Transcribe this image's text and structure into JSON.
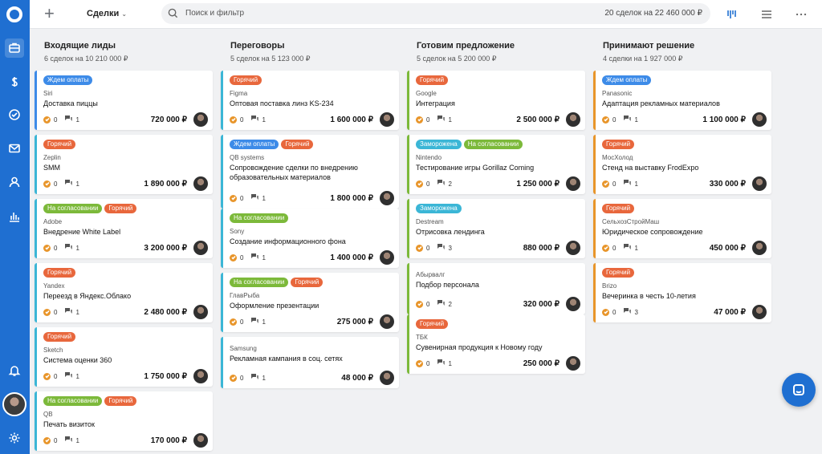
{
  "topbar": {
    "deals_label": "Сделки",
    "search_placeholder": "Поиск и фильтр",
    "deals_count": "20 сделок на 22 460 000 ₽"
  },
  "colors": {
    "ждем оплаты": "#3d8be8",
    "горячий": "#e8673c",
    "на согласовании": "#7cb93a",
    "заморожена": "#3bb6d6"
  },
  "columns": [
    {
      "title": "Входящие лиды",
      "subtitle": "6 сделок на 10 210 000 ₽",
      "cards": [
        {
          "tags": [
            "Ждем оплаты"
          ],
          "company": "Siri",
          "deal": "Доставка пиццы",
          "tasks": "0",
          "comments": "1",
          "amount": "720 000 ₽",
          "accent": "#3d8be8"
        },
        {
          "tags": [
            "Горячий"
          ],
          "company": "Zeplin",
          "deal": "SMM",
          "tasks": "0",
          "comments": "1",
          "amount": "1 890 000 ₽",
          "accent": "#3bb6d6"
        },
        {
          "tags": [
            "На согласовании",
            "Горячий"
          ],
          "company": "Adobe",
          "deal": "Внедрение White Label",
          "tasks": "0",
          "comments": "1",
          "amount": "3 200 000 ₽",
          "accent": "#3bb6d6"
        },
        {
          "tags": [
            "Горячий"
          ],
          "company": "Yandex",
          "deal": "Переезд в Яндекс.Облако",
          "tasks": "0",
          "comments": "1",
          "amount": "2 480 000 ₽",
          "accent": "#3bb6d6"
        },
        {
          "tags": [
            "Горячий"
          ],
          "company": "Sketch",
          "deal": "Система оценки 360",
          "tasks": "0",
          "comments": "1",
          "amount": "1 750 000 ₽",
          "accent": "#3bb6d6"
        },
        {
          "tags": [
            "На согласовании",
            "Горячий"
          ],
          "company": "QB",
          "deal": "Печать визиток",
          "tasks": "0",
          "comments": "1",
          "amount": "170 000 ₽",
          "accent": "#3bb6d6"
        }
      ]
    },
    {
      "title": "Переговоры",
      "subtitle": "5 сделок на 5 123 000 ₽",
      "cards": [
        {
          "tags": [
            "Горячий"
          ],
          "company": "Figma",
          "deal": "Оптовая поставка линз KS-234",
          "tasks": "0",
          "comments": "1",
          "amount": "1 600 000 ₽",
          "accent": "#3bb6d6"
        },
        {
          "tags": [
            "Ждем оплаты",
            "Горячий"
          ],
          "company": "QB systems",
          "deal": "Сопровождение сделки по внедрению образовательных материалов",
          "tasks": "0",
          "comments": "1",
          "amount": "1 800 000 ₽",
          "accent": "#3bb6d6"
        },
        {
          "tags": [
            "На согласовании"
          ],
          "company": "Sony",
          "deal": "Создание информационного фона",
          "tasks": "0",
          "comments": "1",
          "amount": "1 400 000 ₽",
          "accent": "#3bb6d6"
        },
        {
          "tags": [
            "На согласовании",
            "Горячий"
          ],
          "company": "ГлавРыба",
          "deal": "Оформление презентации",
          "tasks": "0",
          "comments": "1",
          "amount": "275 000 ₽",
          "accent": "#3bb6d6"
        },
        {
          "tags": [],
          "company": "Samsung",
          "deal": "Рекламная кампания в соц. сетях",
          "tasks": "0",
          "comments": "1",
          "amount": "48 000 ₽",
          "accent": "#3bb6d6"
        }
      ]
    },
    {
      "title": "Готовим предложение",
      "subtitle": "5 сделок на 5 200 000 ₽",
      "cards": [
        {
          "tags": [
            "Горячий"
          ],
          "company": "Google",
          "deal": "Интеграция",
          "tasks": "0",
          "comments": "1",
          "amount": "2 500 000 ₽",
          "accent": "#7cb93a"
        },
        {
          "tags": [
            "Заморожена",
            "На согласовании"
          ],
          "company": "Nintendo",
          "deal": "Тестирование игры Gorillaz Coming",
          "tasks": "0",
          "comments": "2",
          "amount": "1 250 000 ₽",
          "accent": "#7cb93a"
        },
        {
          "tags": [
            "Заморожена"
          ],
          "company": "Destream",
          "deal": "Отрисовка лендинга",
          "tasks": "0",
          "comments": "3",
          "amount": "880 000 ₽",
          "accent": "#7cb93a"
        },
        {
          "tags": [],
          "company": "Абырвалг",
          "deal": "Подбор персонала",
          "tasks": "0",
          "comments": "2",
          "amount": "320 000 ₽",
          "accent": "#7cb93a"
        },
        {
          "tags": [
            "Горячий"
          ],
          "company": "ТБК",
          "deal": "Сувенирная продукция к Новому году",
          "tasks": "0",
          "comments": "1",
          "amount": "250 000 ₽",
          "accent": "#7cb93a"
        }
      ]
    },
    {
      "title": "Принимают решение",
      "subtitle": "4 сделки на 1 927 000 ₽",
      "cards": [
        {
          "tags": [
            "Ждем оплаты"
          ],
          "company": "Panasonic",
          "deal": "Адаптация рекламных материалов",
          "tasks": "0",
          "comments": "1",
          "amount": "1 100 000 ₽",
          "accent": "#e8952a"
        },
        {
          "tags": [
            "Горячий"
          ],
          "company": "МосХолод",
          "deal": "Стенд на выставку FrodExpo",
          "tasks": "0",
          "comments": "1",
          "amount": "330 000 ₽",
          "accent": "#e8952a"
        },
        {
          "tags": [
            "Горячий"
          ],
          "company": "СельхозСтройМаш",
          "deal": "Юридическое сопровождение",
          "tasks": "0",
          "comments": "1",
          "amount": "450 000 ₽",
          "accent": "#e8952a"
        },
        {
          "tags": [
            "Горячий"
          ],
          "company": "Brizo",
          "deal": "Вечеринка в честь 10-летия",
          "tasks": "0",
          "comments": "3",
          "amount": "47 000 ₽",
          "accent": "#e8952a"
        }
      ]
    }
  ]
}
